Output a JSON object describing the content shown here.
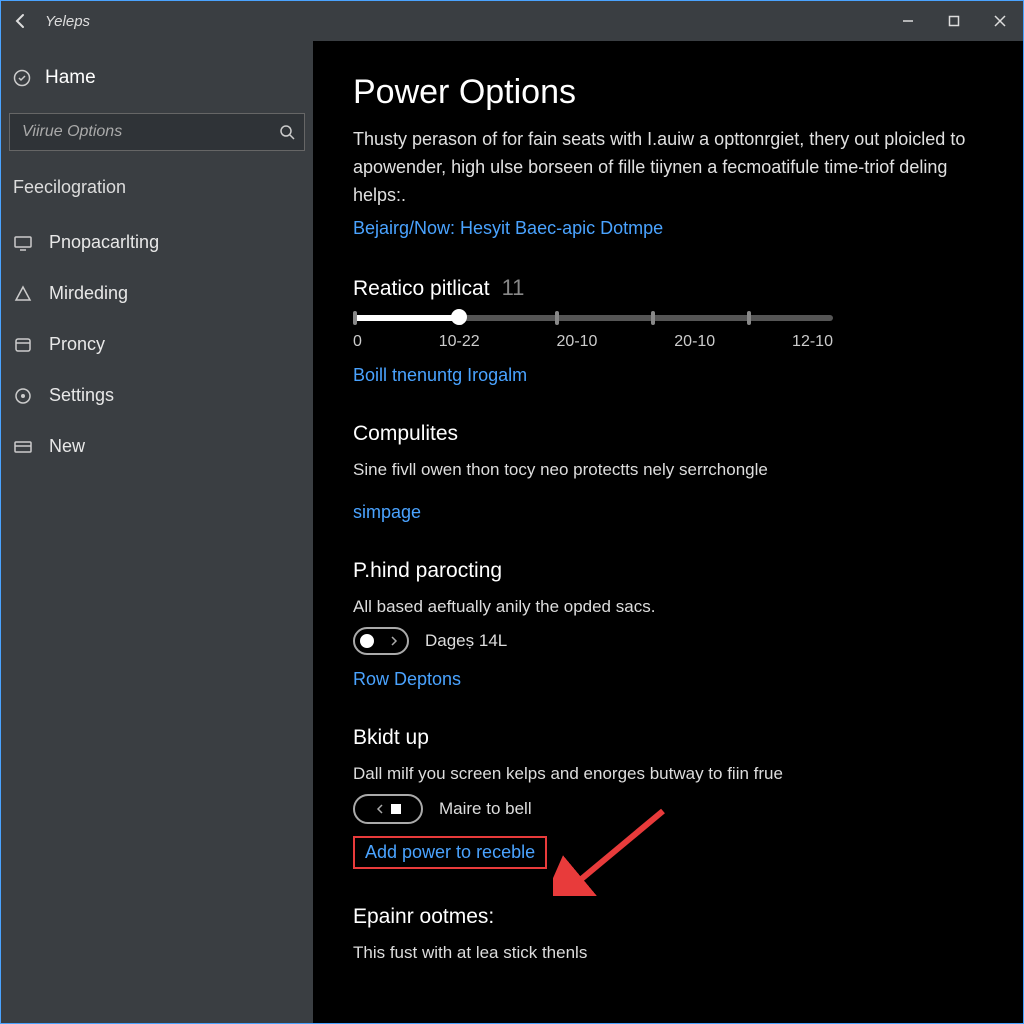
{
  "app": {
    "title": "Yeleps"
  },
  "sidebar": {
    "home_label": "Hame",
    "search_placeholder": "Viirue Options",
    "section_label": "Feecilogration",
    "items": [
      {
        "label": "Pnopacarlting",
        "icon": "display"
      },
      {
        "label": "Mirdeding",
        "icon": "triangle"
      },
      {
        "label": "Proncy",
        "icon": "box"
      },
      {
        "label": "Settings",
        "icon": "circle"
      },
      {
        "label": "New",
        "icon": "card"
      }
    ]
  },
  "main": {
    "title": "Power Options",
    "intro": "Thusty perason of for fain seats with I.auiw a opttonrgiet, thery out ploicled to apowender, high ulse borseen of fille tiiynen a fecmoatifule time-triof deling helps:.",
    "intro_link": "Bejairg/Now: Hesyit Baec-apic Dotmpe",
    "slider": {
      "title": "Reatico pitlicat",
      "value": "11",
      "ticks": [
        "0",
        "10-22",
        "20-10",
        "20-10",
        "12-10"
      ]
    },
    "slider_link": "Boill tnenuntg Irogalm",
    "sec2": {
      "title": "Compulites",
      "desc": "Sine fivll owen thon tocy neo protectts nely serrchongle",
      "link": "simpage"
    },
    "sec3": {
      "title": "P.hind parocting",
      "desc": "All based aeftually anily the opded sacs.",
      "toggle_label": "Dageṣ 14L",
      "link": "Row Deptons"
    },
    "sec4": {
      "title": "Bkidt up",
      "desc": "Dall milf you screen kelps and enorges butway to fiin frue",
      "toggle_label": "Maire to bell",
      "highlight_link": "Add power to receble"
    },
    "sec5": {
      "title": "Epainr ootmes:",
      "desc": "This fust with at lea stick thenls"
    }
  },
  "colors": {
    "link": "#4aa3ff",
    "highlight_border": "#e83b3b"
  }
}
